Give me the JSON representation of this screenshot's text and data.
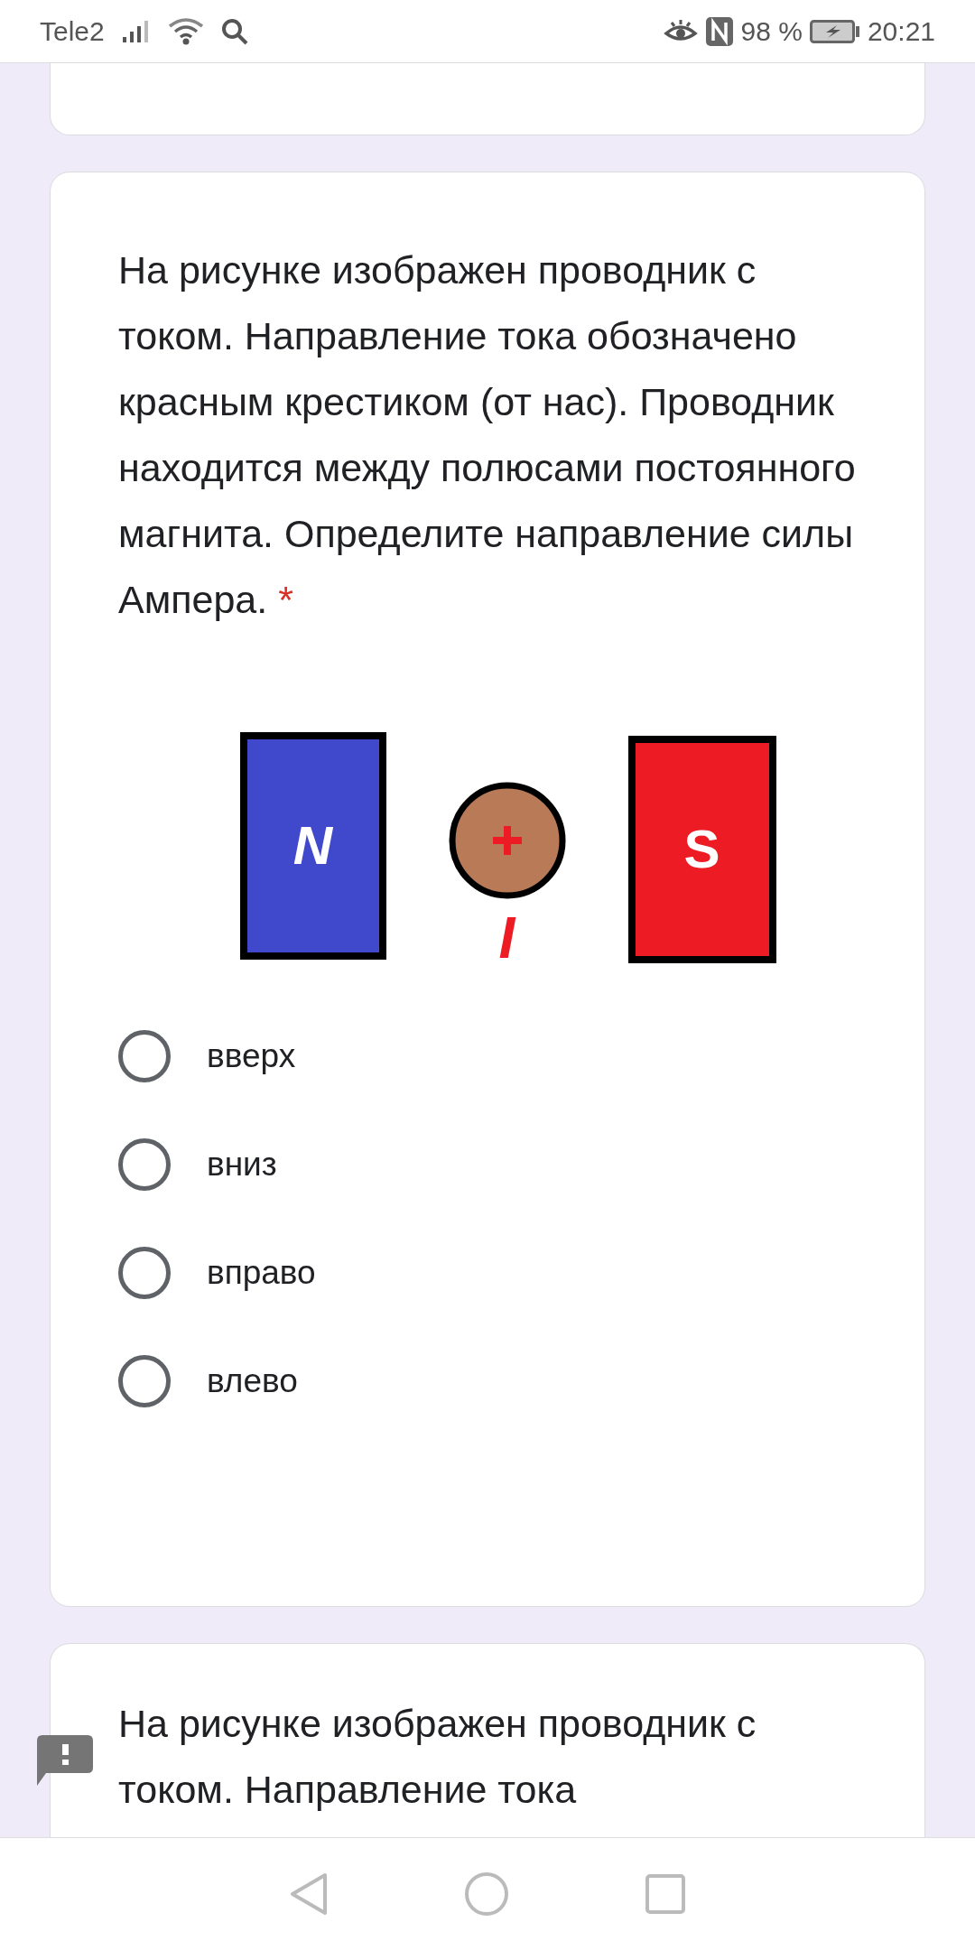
{
  "status_bar": {
    "carrier": "Tele2",
    "battery": "98 %",
    "time": "20:21"
  },
  "question": {
    "text": "На рисунке изображен проводник с током. Направление тока обозначено красным крестиком (от нас). Проводник находится между полюсами постоянного магнита. Определите направление силы Ампера.",
    "required_mark": "*",
    "figure": {
      "left_pole": "N",
      "right_pole": "S",
      "current_label": "I"
    },
    "options": [
      {
        "label": "вверх",
        "selected": false
      },
      {
        "label": "вниз",
        "selected": false
      },
      {
        "label": "вправо",
        "selected": false
      },
      {
        "label": "влево",
        "selected": false
      }
    ]
  },
  "next_question": {
    "text": "На рисунке изображен проводник с током. Направление тока"
  }
}
